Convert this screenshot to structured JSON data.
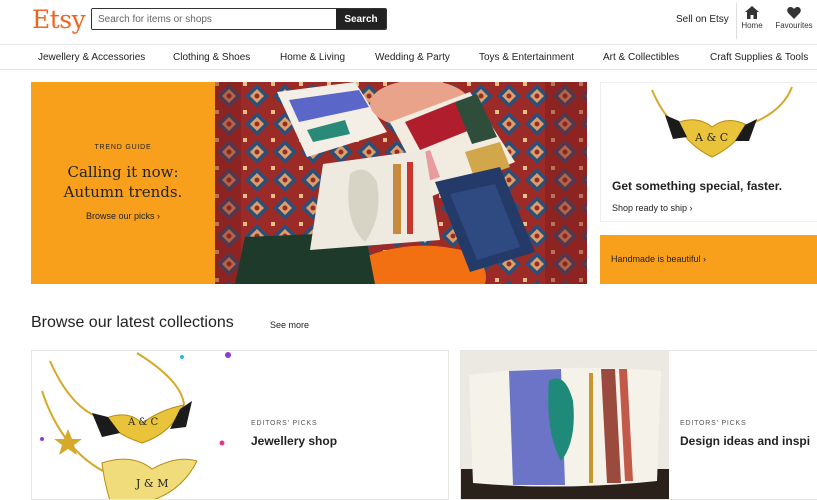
{
  "header": {
    "logo": "Etsy",
    "search_placeholder": "Search for items or shops",
    "search_button": "Search",
    "sell_label": "Sell on Etsy",
    "home_label": "Home",
    "favourites_label": "Favourites"
  },
  "categories": [
    "Jewellery & Accessories",
    "Clothing & Shoes",
    "Home & Living",
    "Wedding & Party",
    "Toys & Entertainment",
    "Art & Collectibles",
    "Craft Supplies & Tools"
  ],
  "hero": {
    "eyebrow": "TREND GUIDE",
    "headline_line1": "Calling it now:",
    "headline_line2": "Autumn trends.",
    "cta": "Browse our picks ›"
  },
  "promo": {
    "title": "Get something special, faster.",
    "link": "Shop ready to ship ›",
    "banner": "Handmade is beautiful ›"
  },
  "collections": {
    "title": "Browse our latest collections",
    "see_more": "See more",
    "items": [
      {
        "eyebrow": "EDITORS' PICKS",
        "name": "Jewellery shop"
      },
      {
        "eyebrow": "EDITORS' PICKS",
        "name": "Design ideas and inspi"
      }
    ]
  },
  "image_text": {
    "necklace_initials": "A & C",
    "necklace_initials_2": "J & M"
  },
  "colors": {
    "brand": "#f1641e",
    "accent": "#f8a01c",
    "dark": "#222222"
  },
  "icons": [
    "house-icon",
    "heart-icon",
    "chevron-right-icon"
  ]
}
